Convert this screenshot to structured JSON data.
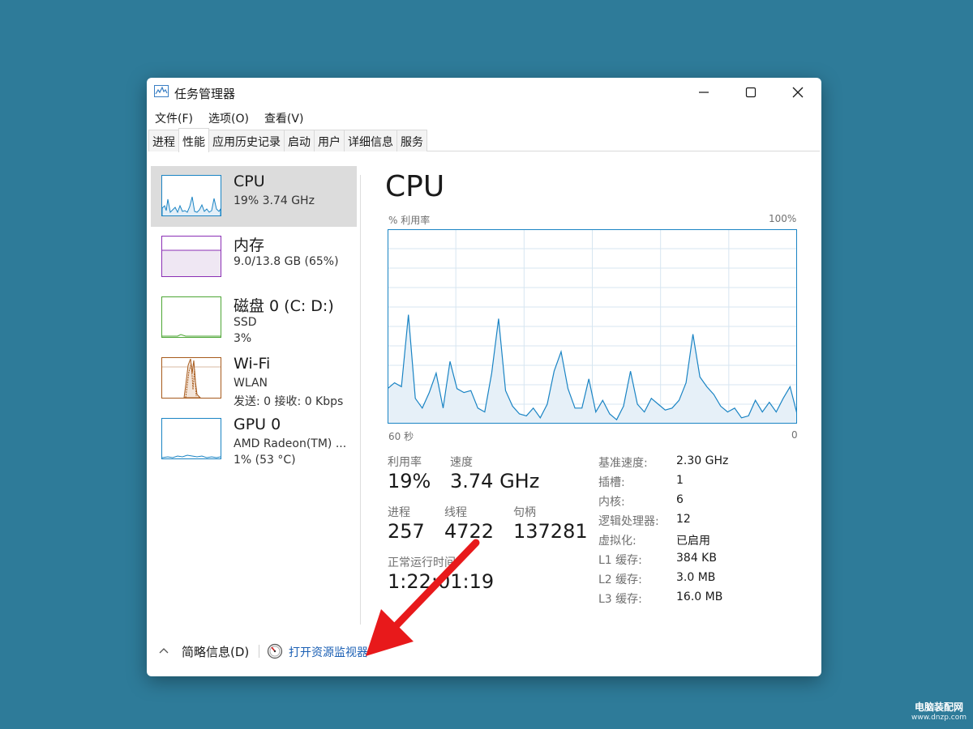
{
  "window": {
    "title": "任务管理器"
  },
  "menu": [
    "文件(F)",
    "选项(O)",
    "查看(V)"
  ],
  "tabs": [
    "进程",
    "性能",
    "应用历史记录",
    "启动",
    "用户",
    "详细信息",
    "服务"
  ],
  "active_tab": "性能",
  "sidebar": [
    {
      "name": "CPU",
      "sub1": "19%  3.74 GHz",
      "sub2": "",
      "color": "#1a84c4"
    },
    {
      "name": "内存",
      "sub1": "9.0/13.8 GB (65%)",
      "sub2": "",
      "color": "#8b2fb5"
    },
    {
      "name": "磁盘 0 (C: D:)",
      "sub1": "SSD",
      "sub2": "3%",
      "color": "#4da635"
    },
    {
      "name": "Wi-Fi",
      "sub1": "WLAN",
      "sub2": "发送: 0 接收: 0 Kbps",
      "color": "#a75a1c"
    },
    {
      "name": "GPU 0",
      "sub1": "AMD Radeon(TM) ...",
      "sub2": "1% (53 °C)",
      "color": "#1a84c4"
    }
  ],
  "main": {
    "title": "CPU",
    "graph_label_left": "% 利用率",
    "graph_label_right": "100%",
    "axis_left": "60 秒",
    "axis_right": "0",
    "stats": {
      "util_label": "利用率",
      "util_value": "19%",
      "speed_label": "速度",
      "speed_value": "3.74 GHz",
      "proc_label": "进程",
      "proc_value": "257",
      "thread_label": "线程",
      "thread_value": "4722",
      "handle_label": "句柄",
      "handle_value": "137281",
      "uptime_label": "正常运行时间",
      "uptime_value": "1:22:01:19"
    },
    "specs": [
      {
        "label": "基准速度:",
        "value": "2.30 GHz"
      },
      {
        "label": "插槽:",
        "value": "1"
      },
      {
        "label": "内核:",
        "value": "6"
      },
      {
        "label": "逻辑处理器:",
        "value": "12"
      },
      {
        "label": "虚拟化:",
        "value": "已启用"
      },
      {
        "label": "L1 缓存:",
        "value": "384 KB"
      },
      {
        "label": "L2 缓存:",
        "value": "3.0 MB"
      },
      {
        "label": "L3 缓存:",
        "value": "16.0 MB"
      }
    ]
  },
  "footer": {
    "summary": "简略信息(D)",
    "monitor_link": "打开资源监视器"
  },
  "watermark": {
    "line1": "电脑装配网",
    "line2": "www.dnzp.com"
  },
  "colors": {
    "desktop": "#2e7b99",
    "graph_line": "#1a84c4",
    "arrow": "#e8191b"
  },
  "chart_data": {
    "type": "area",
    "ylim": [
      0,
      100
    ],
    "y": [
      18,
      21,
      19,
      56,
      13,
      8,
      16,
      26,
      8,
      32,
      18,
      16,
      17,
      8,
      6,
      26,
      54,
      17,
      9,
      5,
      4,
      8,
      3,
      10,
      27,
      37,
      18,
      8,
      8,
      23,
      6,
      12,
      5,
      2,
      9,
      27,
      10,
      6,
      13,
      10,
      7,
      8,
      12,
      21,
      46,
      24,
      19,
      15,
      9,
      6,
      8,
      3,
      4,
      12,
      6,
      11,
      6,
      13,
      19,
      5
    ]
  }
}
